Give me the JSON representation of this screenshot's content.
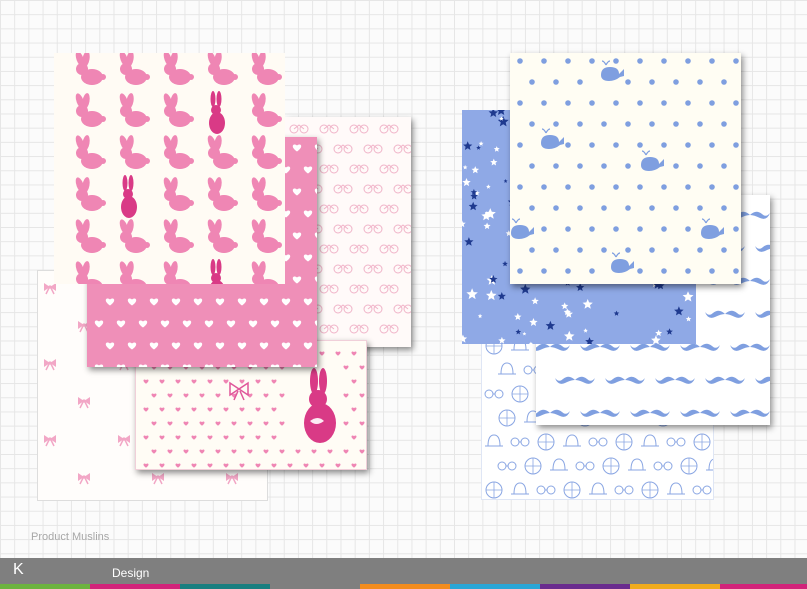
{
  "caption": "Product Muslins",
  "footer": {
    "logo": "K",
    "section": "Design"
  },
  "colors": {
    "bar": "#7f7f7f",
    "stripe_colors": [
      "#6cb33f",
      "#d2237a",
      "#1a7f80",
      "#7f7f7f",
      "#f28c1e",
      "#2aa6d6",
      "#6a2c8e",
      "#f0ab1c",
      "#d2237a"
    ],
    "pink": "#ed7fae",
    "pink_dark": "#d93a86",
    "blue": "#7f9fe0",
    "navy": "#1f3a8f"
  },
  "sheets": [
    {
      "name": "bunny-print",
      "pattern": "bunny"
    },
    {
      "name": "bicycle-print",
      "pattern": "bicycle-outline"
    },
    {
      "name": "pink-hearts-print",
      "pattern": "white-hearts-on-pink"
    },
    {
      "name": "bows-print",
      "pattern": "pink-bows"
    },
    {
      "name": "small-hearts-print",
      "pattern": "pink-hearts-with-bunny"
    },
    {
      "name": "stars-print",
      "pattern": "stars-on-blue"
    },
    {
      "name": "whale-dots-print",
      "pattern": "blue-dots-whales"
    },
    {
      "name": "mustache-print",
      "pattern": "blue-mustaches"
    },
    {
      "name": "gentleman-print",
      "pattern": "hats-glasses-bikes-outline"
    }
  ]
}
